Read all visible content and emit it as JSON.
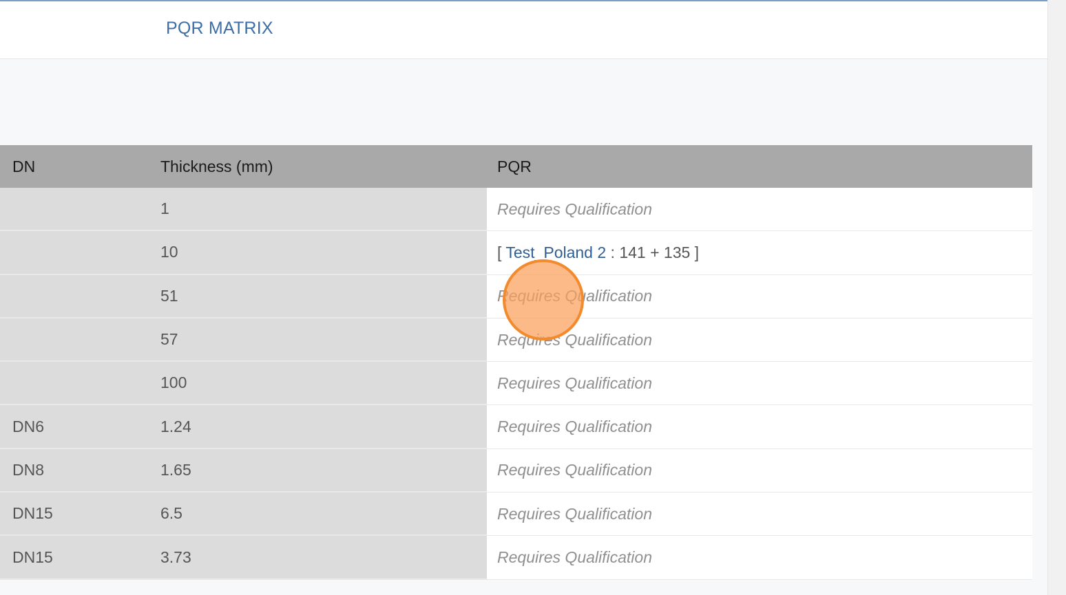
{
  "header": {
    "title": "PQR MATRIX"
  },
  "table": {
    "columns": [
      "DN",
      "Thickness (mm)",
      "PQR"
    ],
    "rows": [
      {
        "dn": "",
        "thickness": "1",
        "pqr": "Requires Qualification"
      },
      {
        "dn": "",
        "thickness": "10",
        "pqr_prefix": "[ ",
        "pqr_link": "Test_Poland 2",
        "pqr_suffix": " : 141 + 135 ]"
      },
      {
        "dn": "",
        "thickness": "51",
        "pqr": "Requires Qualification"
      },
      {
        "dn": "",
        "thickness": "57",
        "pqr": "Requires Qualification"
      },
      {
        "dn": "",
        "thickness": "100",
        "pqr": "Requires Qualification"
      },
      {
        "dn": "DN6",
        "thickness": "1.24",
        "pqr": "Requires Qualification"
      },
      {
        "dn": "DN8",
        "thickness": "1.65",
        "pqr": "Requires Qualification"
      },
      {
        "dn": "DN15",
        "thickness": "6.5",
        "pqr": "Requires Qualification"
      },
      {
        "dn": "DN15",
        "thickness": "3.73",
        "pqr": "Requires Qualification"
      }
    ]
  },
  "colors": {
    "accent": "#3d6ea5",
    "header_bg": "#a9a9a9",
    "left_cells_bg": "#dcdcdc",
    "link": "#2f5f95",
    "click_marker": "#f28a2e"
  }
}
